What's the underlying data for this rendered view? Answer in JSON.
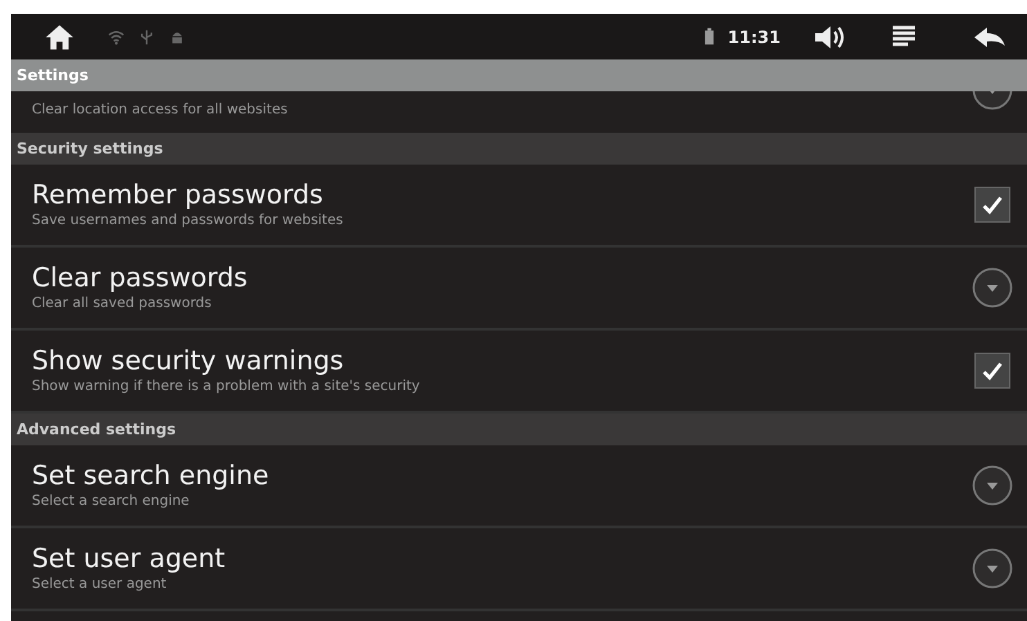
{
  "status_bar": {
    "time": "11:31"
  },
  "title": "Settings",
  "items": [
    {
      "kind": "dropdown",
      "subtitle": "Clear location access for all websites"
    },
    {
      "kind": "section",
      "title": "Security settings"
    },
    {
      "kind": "checkbox",
      "title": "Remember passwords",
      "subtitle": "Save usernames and passwords for websites",
      "checked": true
    },
    {
      "kind": "dropdown",
      "title": "Clear passwords",
      "subtitle": "Clear all saved passwords"
    },
    {
      "kind": "checkbox",
      "title": "Show security warnings",
      "subtitle": "Show warning if there is a problem with a site's security",
      "checked": true
    },
    {
      "kind": "section",
      "title": "Advanced settings"
    },
    {
      "kind": "dropdown",
      "title": "Set search engine",
      "subtitle": "Select a search engine"
    },
    {
      "kind": "dropdown",
      "title": "Set user agent",
      "subtitle": "Select a user agent"
    }
  ]
}
